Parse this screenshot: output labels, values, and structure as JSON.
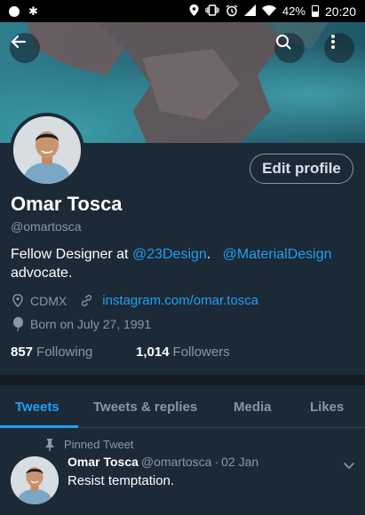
{
  "status_bar": {
    "battery": "42%",
    "time": "20:20"
  },
  "banner": {
    "back_icon": "arrow-left-icon",
    "search_icon": "search-icon",
    "more_icon": "more-vertical-icon"
  },
  "profile": {
    "edit_label": "Edit profile",
    "name": "Omar Tosca",
    "handle": "@omartosca",
    "bio_prefix": "Fellow Designer at ",
    "bio_mention_1": "@23Design",
    "bio_middle": ".   ",
    "bio_mention_2": "@MaterialDesign",
    "bio_suffix": " advocate.",
    "location": "CDMX",
    "website": "instagram.com/omar.tosca",
    "born": "Born on July 27, 1991",
    "following_count": "857",
    "following_label": "Following",
    "followers_count": "1,014",
    "followers_label": "Followers"
  },
  "tabs": [
    {
      "label": "Tweets",
      "active": true
    },
    {
      "label": "Tweets & replies",
      "active": false
    },
    {
      "label": "Media",
      "active": false
    },
    {
      "label": "Likes",
      "active": false
    }
  ],
  "tweet": {
    "pinned_label": "Pinned Tweet",
    "name": "Omar Tosca",
    "handle": "@omartosca",
    "separator": "·",
    "date": "02 Jan",
    "text": "Resist temptation."
  },
  "colors": {
    "background": "#1c2937",
    "accent": "#1da1f2",
    "secondary_text": "#8899a6"
  }
}
